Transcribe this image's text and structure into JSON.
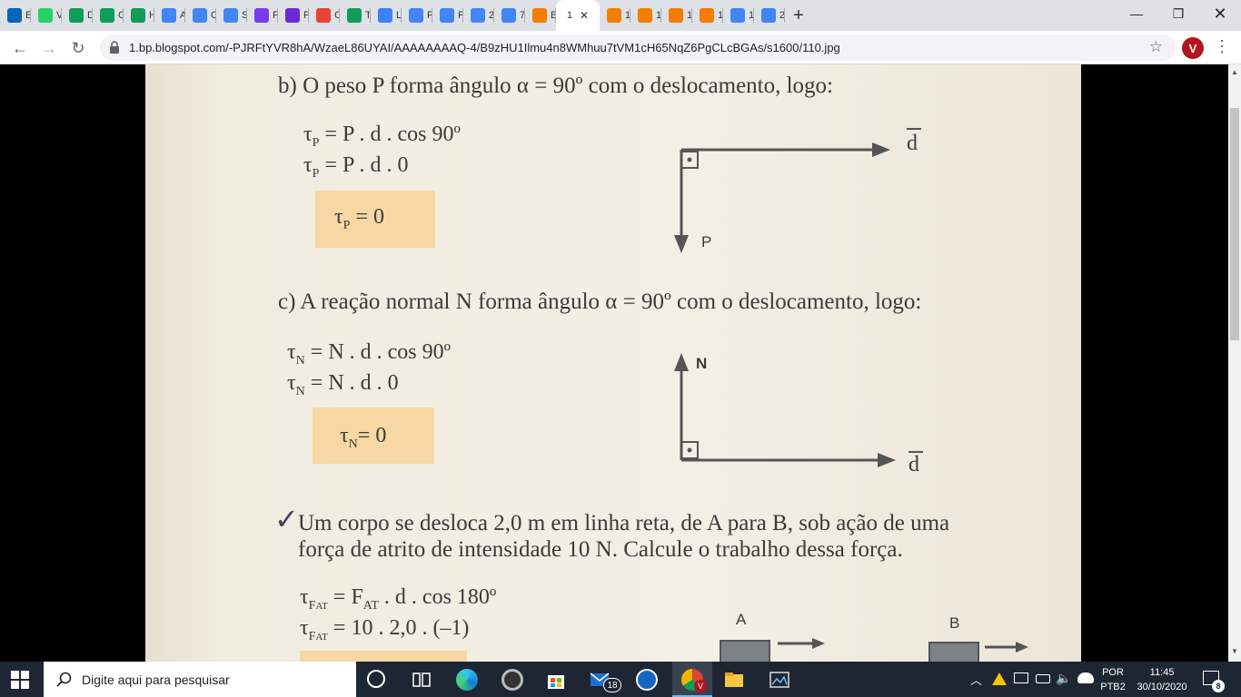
{
  "browser": {
    "tabs": [
      {
        "label": "E",
        "icon": "outlook-icon",
        "color": "#0364b8"
      },
      {
        "label": "V",
        "icon": "whatsapp-icon",
        "color": "#25d366"
      },
      {
        "label": "D",
        "icon": "sheets-plus-icon",
        "color": "#0f9d58"
      },
      {
        "label": "C",
        "icon": "sheets-plus-icon",
        "color": "#0f9d58"
      },
      {
        "label": "H",
        "icon": "sheets-plus-icon",
        "color": "#0f9d58"
      },
      {
        "label": "A",
        "icon": "docs-icon",
        "color": "#4285f4"
      },
      {
        "label": "C",
        "icon": "docs-icon",
        "color": "#4285f4"
      },
      {
        "label": "S",
        "icon": "docs-icon",
        "color": "#4285f4"
      },
      {
        "label": "P",
        "icon": "purple-circle-icon",
        "color": "#7c3aed"
      },
      {
        "label": "P",
        "icon": "purple-square-icon",
        "color": "#6d28d9"
      },
      {
        "label": "C",
        "icon": "gmail-icon",
        "color": "#ea4335"
      },
      {
        "label": "T",
        "icon": "sheets-plus-icon",
        "color": "#0f9d58"
      },
      {
        "label": "L",
        "icon": "drop-icon",
        "color": "#3b82f6"
      },
      {
        "label": "P",
        "icon": "docs-icon",
        "color": "#4285f4"
      },
      {
        "label": "P",
        "icon": "docs-icon",
        "color": "#4285f4"
      },
      {
        "label": "2",
        "icon": "docs-icon",
        "color": "#4285f4"
      },
      {
        "label": "7",
        "icon": "docs-icon",
        "color": "#4285f4"
      },
      {
        "label": "B",
        "icon": "blogger-icon",
        "color": "#f57d00"
      },
      {
        "label": "1",
        "icon": "none",
        "color": "#ffffff",
        "active": true
      },
      {
        "label": "1",
        "icon": "blogger-icon",
        "color": "#f57d00"
      },
      {
        "label": "1",
        "icon": "blogger-icon",
        "color": "#f57d00"
      },
      {
        "label": "1",
        "icon": "blogger-icon",
        "color": "#f57d00"
      },
      {
        "label": "1",
        "icon": "blogger-icon",
        "color": "#f57d00"
      },
      {
        "label": "1",
        "icon": "docs-icon",
        "color": "#4285f4"
      },
      {
        "label": "2",
        "icon": "docs-icon",
        "color": "#4285f4"
      }
    ],
    "close_glyph": "✕",
    "new_tab_glyph": "+",
    "url": "1.bp.blogspot.com/-PJRFtYVR8hA/WzaeL86UYAI/AAAAAAAAQ-4/B9zHU1Ilmu4n8WMhuu7tVM1cH65NqZ6PgCLcBGAs/s1600/110.jpg",
    "profile_initial": "V"
  },
  "document": {
    "section_b": {
      "heading": "b) O peso P forma ângulo α = 90º com o deslocamento, logo:",
      "line1": "= P . d . cos 90º",
      "line2": "= P . d . 0",
      "result": "= 0",
      "tau": "τ",
      "sub": "P",
      "label_d": "d",
      "label_p": "P"
    },
    "section_c": {
      "heading": "c) A reação normal N forma ângulo α = 90º com o deslocamento, logo:",
      "line1": "= N . d . cos 90º",
      "line2": "= N . d . 0",
      "result": "= 0",
      "tau": "τ",
      "sub": "N",
      "label_n": "N",
      "label_d": "d"
    },
    "exercise": {
      "check": "✓",
      "text1": "Um corpo se desloca 2,0 m em linha reta, de A para B, sob ação de uma",
      "text2": "força de atrito de intensidade 10 N. Calcule o trabalho dessa força.",
      "line1": "= F",
      "line1_sub": "AT",
      "line1_rest": ". d . cos 180º",
      "line2": "= 10 . 2,0 . (–1)",
      "tau": "τ",
      "sub": "F",
      "sub2": "AT",
      "label_a": "A",
      "label_b": "B"
    }
  },
  "taskbar": {
    "search_placeholder": "Digite aqui para pesquisar",
    "mail_badge": "18",
    "lang_top": "POR",
    "lang_bottom": "PTB2",
    "time": "11:45",
    "date": "30/10/2020",
    "notif_count": "8"
  }
}
